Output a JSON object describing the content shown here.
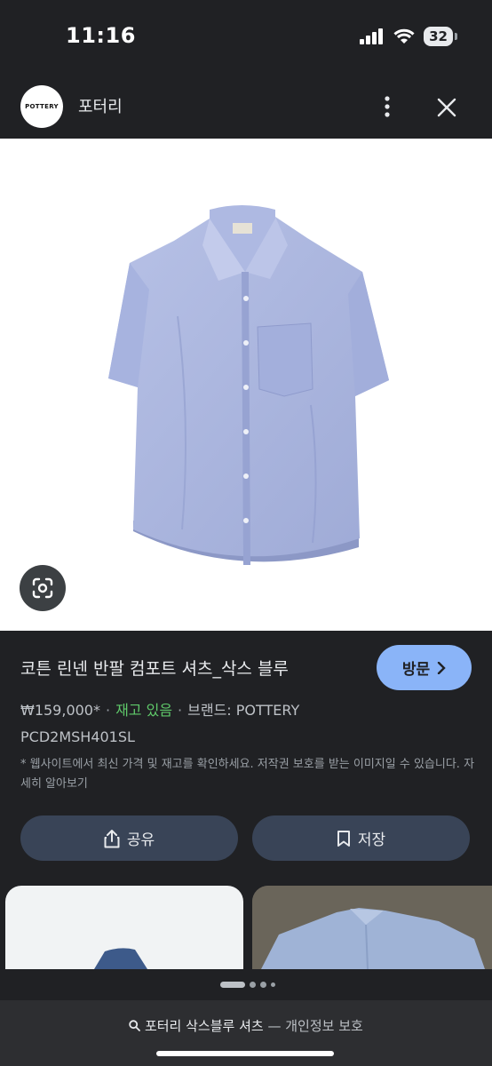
{
  "status_bar": {
    "time": "11:16",
    "battery": "32"
  },
  "header": {
    "logo_text": "POTTERY",
    "site_name": "포터리"
  },
  "product": {
    "title": "코튼 린넨 반팔 컴포트 셔츠_삭스 블루",
    "visit_label": "방문",
    "price": "₩159,000*",
    "stock": "재고 있음",
    "brand": "브랜드: POTTERY",
    "sku": "PCD2MSH401SL",
    "note": "* 웹사이트에서 최신 가격 및 재고를 확인하세요. 저작권 보호를 받는 이미지일 수 있습니다.",
    "learn_more": "자세히 알아보기"
  },
  "actions": {
    "share_label": "공유",
    "save_label": "저장"
  },
  "bottom": {
    "query": "포터리 삭스블루 셔츠",
    "separator": "—",
    "privacy": "개인정보 보호"
  },
  "colors": {
    "background": "#202124",
    "accent": "#8ab4f8",
    "button": "#394457",
    "stock": "#5fc96a",
    "shirt": "#aab6de"
  },
  "icons": [
    "signal-icon",
    "wifi-icon",
    "battery-icon",
    "more-vert-icon",
    "close-icon",
    "lens-icon",
    "chevron-right-icon",
    "share-icon",
    "bookmark-icon",
    "search-icon"
  ]
}
